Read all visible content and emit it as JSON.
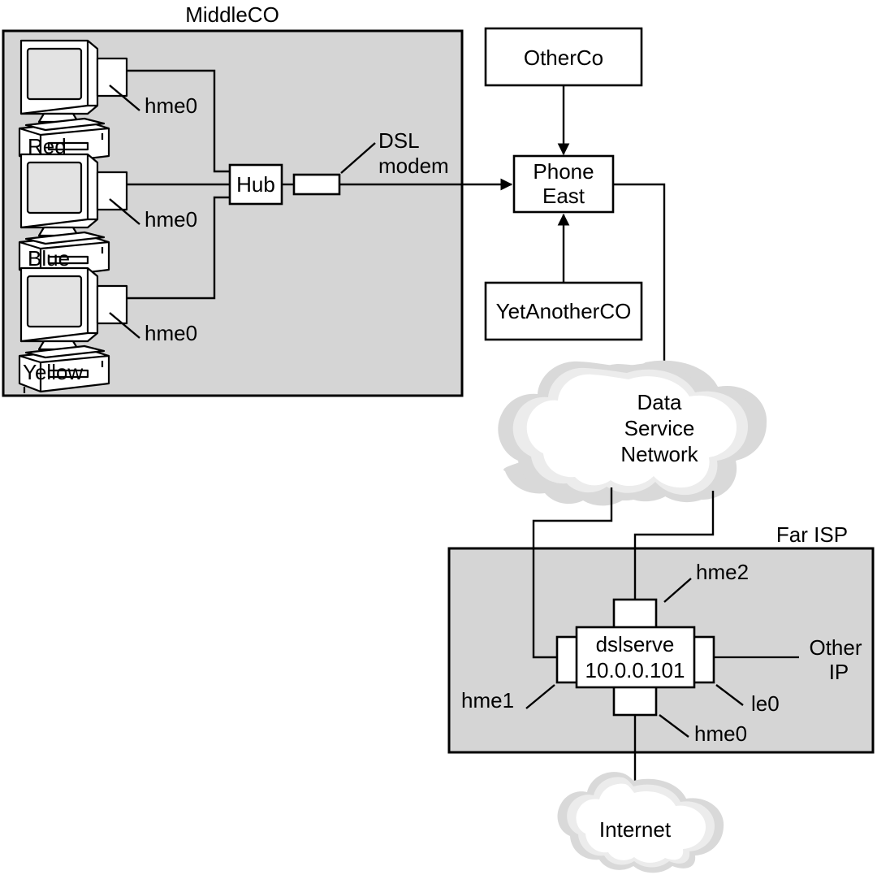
{
  "diagram": {
    "title_visible": false,
    "zones": [
      {
        "id": "middleco",
        "label": "MiddleCO"
      },
      {
        "id": "farisp",
        "label": "Far ISP"
      }
    ],
    "hosts": [
      {
        "id": "red",
        "name": "Red",
        "interface": "hme0"
      },
      {
        "id": "blue",
        "name": "Blue",
        "interface": "hme0"
      },
      {
        "id": "yellow",
        "name": "Yellow",
        "interface": "hme0"
      }
    ],
    "devices": {
      "hub": "Hub",
      "dsl_modem": "DSL\nmodem",
      "dsl_modem_line1": "DSL",
      "dsl_modem_line2": "modem"
    },
    "boxes": [
      {
        "id": "otherco",
        "label": "OtherCo"
      },
      {
        "id": "phone-east",
        "label_line1": "Phone",
        "label_line2": "East"
      },
      {
        "id": "yetanotherco",
        "label": "YetAnotherCO"
      }
    ],
    "clouds": [
      {
        "id": "data-service-network",
        "line1": "Data",
        "line2": "Service",
        "line3": "Network"
      },
      {
        "id": "internet",
        "line1": "Internet"
      }
    ],
    "server": {
      "name": "dslserve",
      "ip": "10.0.0.101",
      "interfaces": [
        {
          "id": "hme2",
          "label": "hme2",
          "side": "top"
        },
        {
          "id": "hme1",
          "label": "hme1",
          "side": "left"
        },
        {
          "id": "le0",
          "label": "le0",
          "side": "right"
        },
        {
          "id": "hme0",
          "label": "hme0",
          "side": "bottom"
        }
      ],
      "right_link_line1": "Other",
      "right_link_line2": "IP"
    },
    "colors": {
      "zone_fill": "#d5d5d5",
      "zone_stroke": "#000000",
      "box_fill": "#ffffff",
      "line": "#000000",
      "cloud_outer": "#d9d9d9",
      "cloud_mid": "#ececec",
      "cloud_inner": "#ffffff"
    }
  }
}
